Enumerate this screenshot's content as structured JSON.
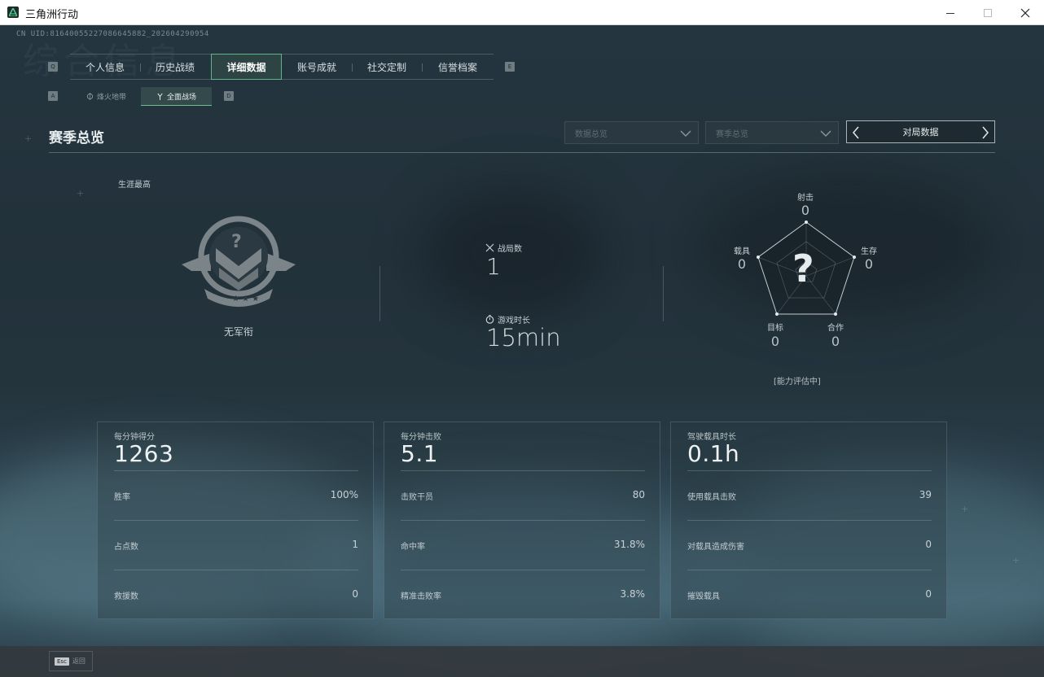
{
  "window": {
    "title": "三角洲行动"
  },
  "uid": "CN UID:8164005522708664588​2_202604290954",
  "background_text": "综合信息",
  "tabs": {
    "left_key": "Q",
    "right_key": "E",
    "items": [
      {
        "label": "个人信息"
      },
      {
        "label": "历史战绩"
      },
      {
        "label": "详细数据",
        "active": true
      },
      {
        "label": "账号成就"
      },
      {
        "label": "社交定制"
      },
      {
        "label": "信誉档案"
      }
    ]
  },
  "subtabs": {
    "left_key": "A",
    "right_key": "D",
    "items": [
      {
        "label": "烽火地带",
        "icon": "flame-icon"
      },
      {
        "label": "全面战场",
        "icon": "fork-icon",
        "active": true
      }
    ]
  },
  "section": {
    "title": "赛季总览"
  },
  "filters": {
    "dropdown1": "数据总览",
    "dropdown2": "赛季总览",
    "pager_label": "对局数据"
  },
  "career": {
    "label": "生涯最高",
    "rank_label": "无军衔",
    "rank_symbol": "?"
  },
  "summary": {
    "matches_label": "战局数",
    "matches_value": "1",
    "time_label": "游戏时长",
    "time_value": "15min"
  },
  "radar": {
    "axes": [
      {
        "label": "射击",
        "value": "0"
      },
      {
        "label": "生存",
        "value": "0"
      },
      {
        "label": "合作",
        "value": "0"
      },
      {
        "label": "目标",
        "value": "0"
      },
      {
        "label": "载具",
        "value": "0"
      }
    ],
    "center_symbol": "?",
    "note": "[能力评估中]"
  },
  "cards": [
    {
      "title": "每分钟得分",
      "value": "1263",
      "rows": [
        {
          "label": "胜率",
          "value": "100%"
        },
        {
          "label": "占点数",
          "value": "1"
        },
        {
          "label": "救援数",
          "value": "0"
        }
      ]
    },
    {
      "title": "每分钟击败",
      "value": "5.1",
      "rows": [
        {
          "label": "击败干员",
          "value": "80"
        },
        {
          "label": "命中率",
          "value": "31.8%"
        },
        {
          "label": "精准击败率",
          "value": "3.8%"
        }
      ]
    },
    {
      "title": "驾驶载具时长",
      "value": "0.1h",
      "rows": [
        {
          "label": "使用载具击败",
          "value": "39"
        },
        {
          "label": "对载具造成伤害",
          "value": "0"
        },
        {
          "label": "摧毁载具",
          "value": "0"
        }
      ]
    }
  ],
  "footer": {
    "esc_key": "Esc",
    "esc_label": "返回"
  },
  "colors": {
    "accent": "#5fb58a",
    "panel": "#1d2a33"
  }
}
